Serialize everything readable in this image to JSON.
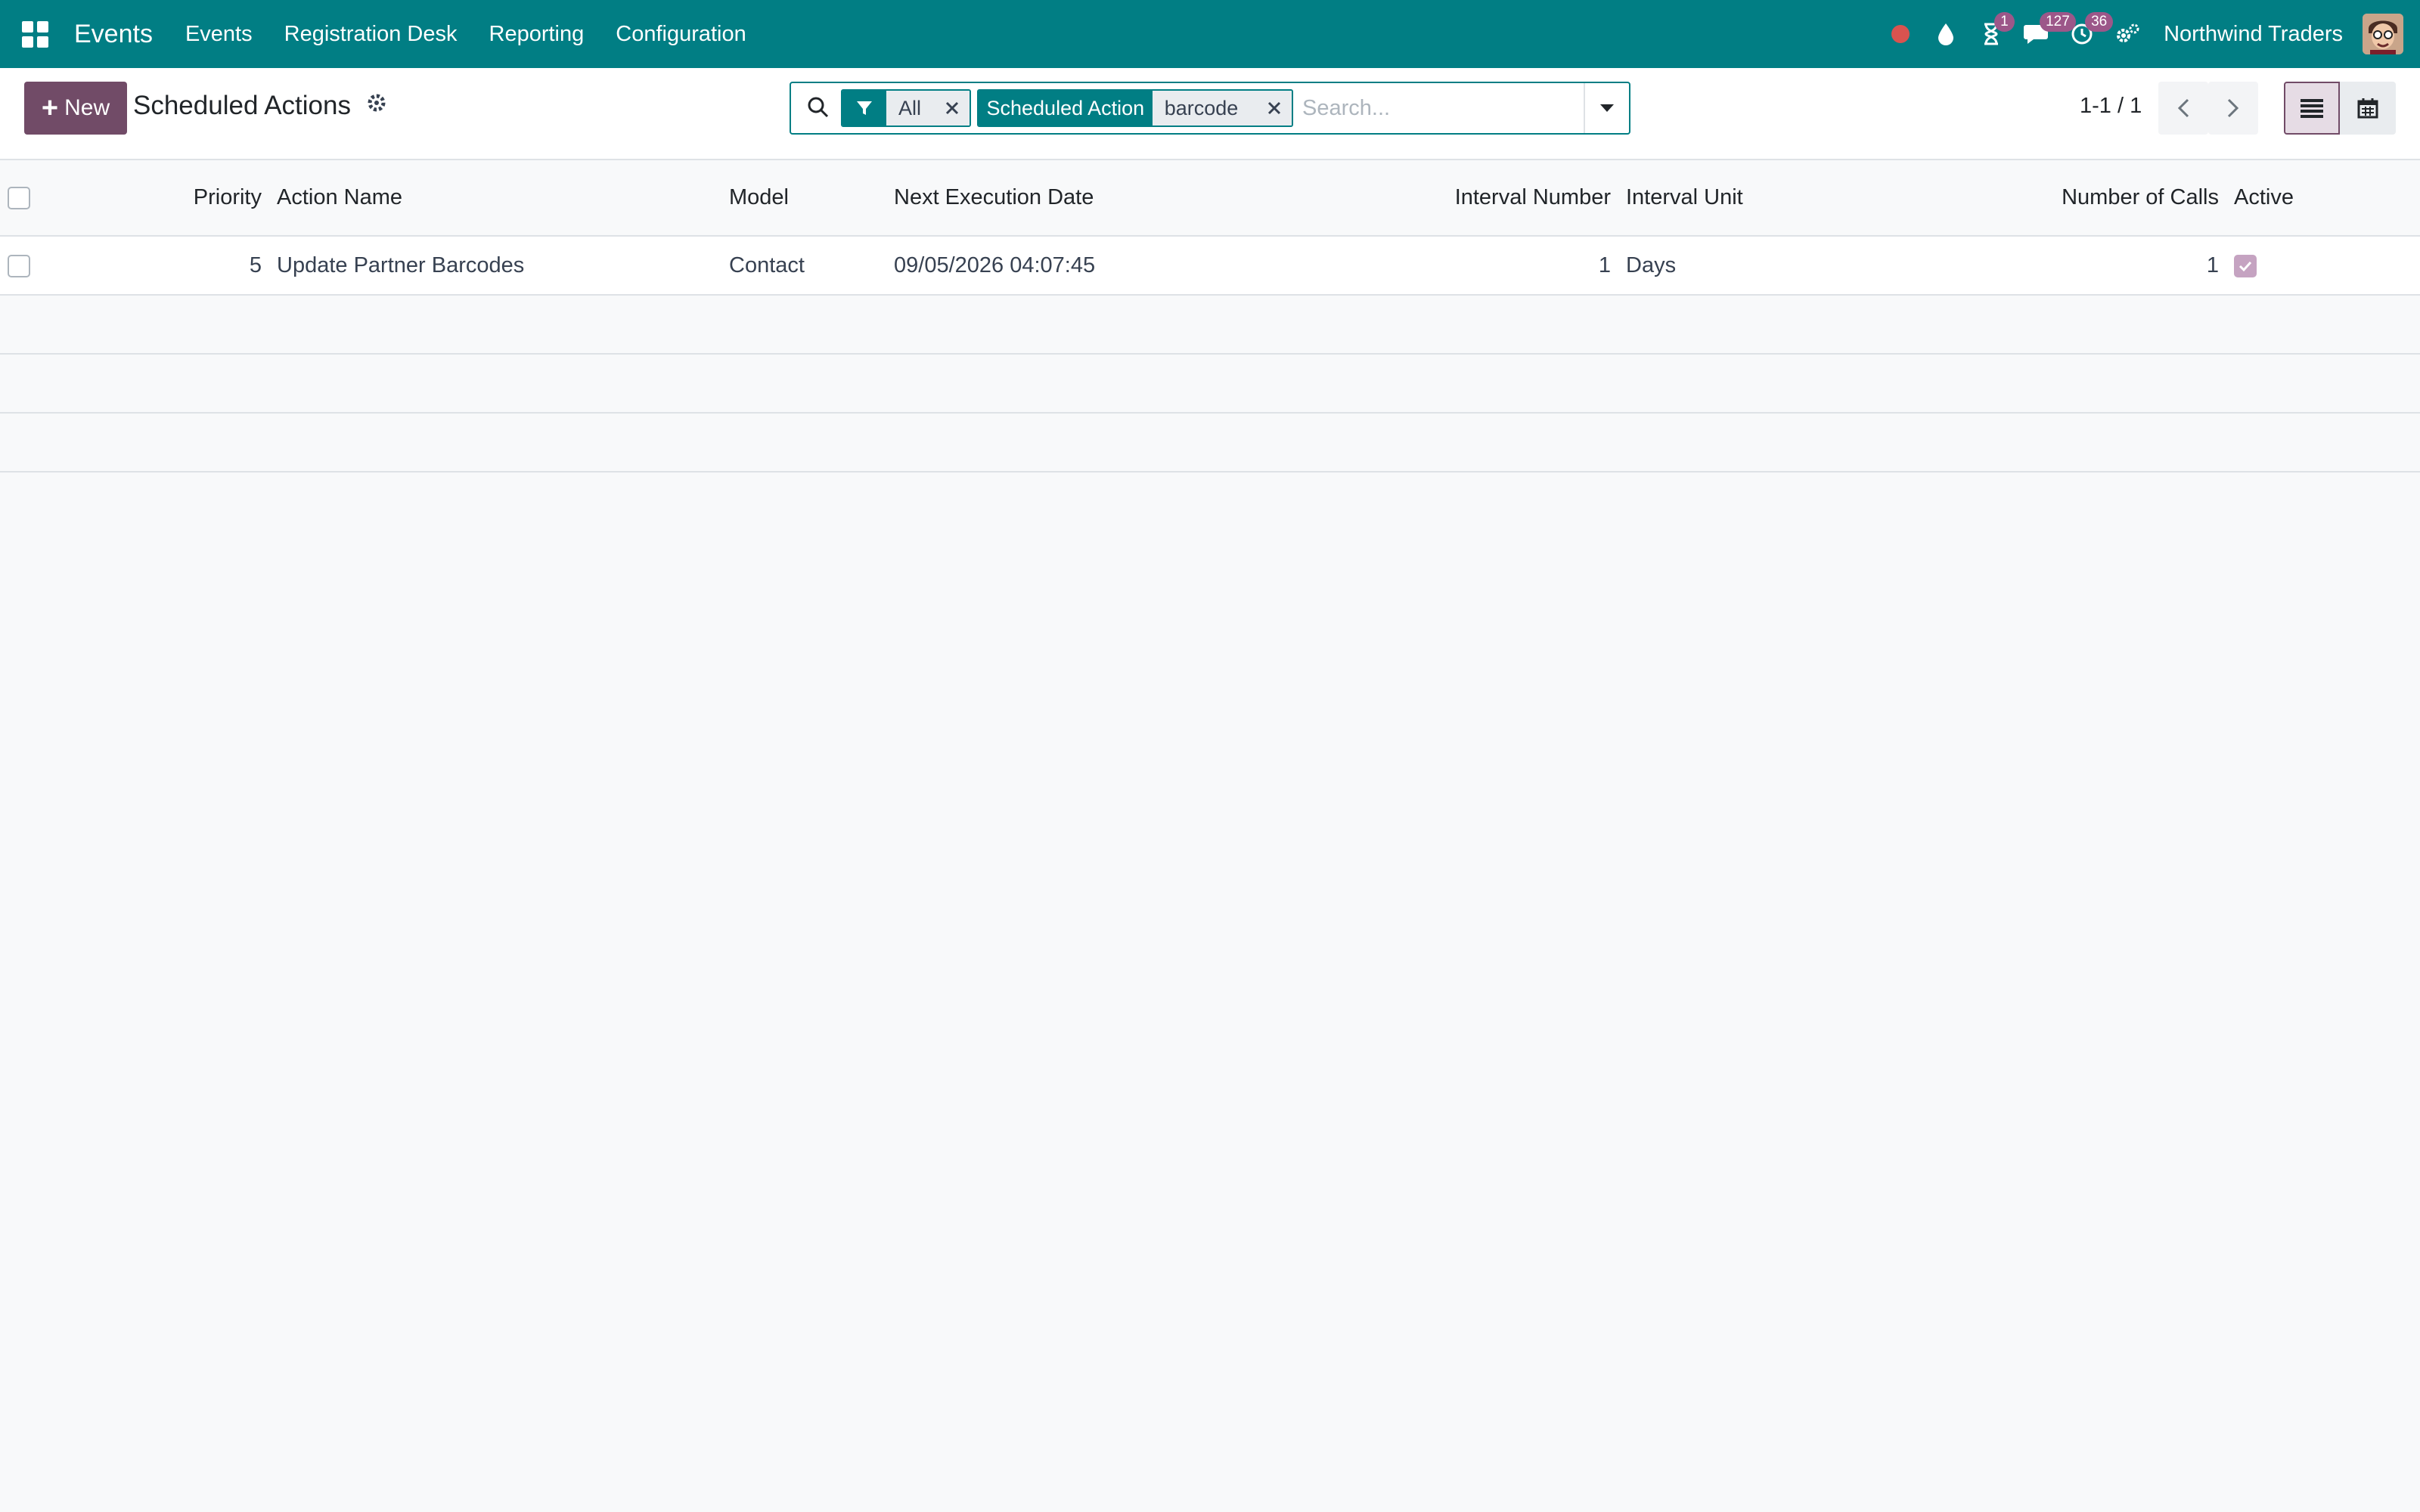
{
  "navbar": {
    "app_name": "Events",
    "menu": [
      "Events",
      "Registration Desk",
      "Reporting",
      "Configuration"
    ],
    "activity_badge": "1",
    "messages_badge": "127",
    "timer_badge": "36",
    "company": "Northwind Traders",
    "record_color": "#d9534f"
  },
  "control_panel": {
    "new_label": "New",
    "title": "Scheduled Actions",
    "search": {
      "facets": [
        {
          "label_icon": "filter-icon",
          "value": "All"
        },
        {
          "label": "Scheduled Action",
          "value": "barcode"
        }
      ],
      "placeholder": "Search..."
    },
    "pager": "1-1 / 1"
  },
  "table": {
    "columns": [
      "Priority",
      "Action Name",
      "Model",
      "Next Execution Date",
      "Interval Number",
      "Interval Unit",
      "Number of Calls",
      "Active"
    ],
    "rows": [
      {
        "priority": "5",
        "action_name": "Update Partner Barcodes",
        "model": "Contact",
        "next_execution_date": "09/05/2026 04:07:45",
        "interval_number": "1",
        "interval_unit": "Days",
        "number_of_calls": "1",
        "active": true
      }
    ]
  },
  "colors": {
    "primary": "#017e84",
    "brand": "#714b67",
    "badge": "#9c5789"
  }
}
